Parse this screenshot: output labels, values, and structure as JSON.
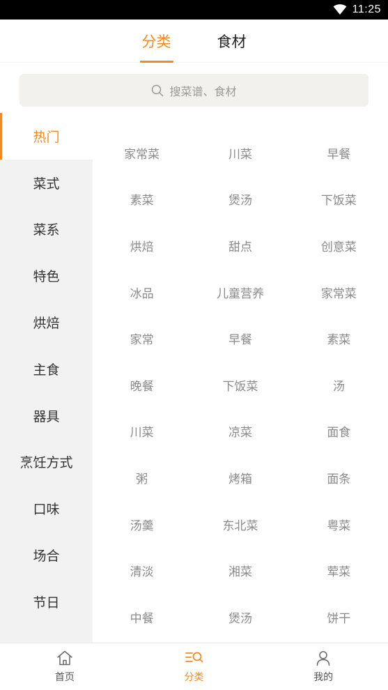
{
  "status_bar": {
    "time": "11:25"
  },
  "top_tabs": [
    {
      "label": "分类",
      "active": true
    },
    {
      "label": "食材",
      "active": false
    }
  ],
  "search": {
    "placeholder": "搜菜谱、食材"
  },
  "sidebar": {
    "items": [
      {
        "label": "热门",
        "active": true
      },
      {
        "label": "菜式"
      },
      {
        "label": "菜系"
      },
      {
        "label": "特色"
      },
      {
        "label": "烘焙"
      },
      {
        "label": "主食"
      },
      {
        "label": "器具"
      },
      {
        "label": "烹饪方式"
      },
      {
        "label": "口味"
      },
      {
        "label": "场合"
      },
      {
        "label": "节日"
      }
    ]
  },
  "grid": {
    "rows": [
      [
        "家常菜",
        "川菜",
        "早餐"
      ],
      [
        "素菜",
        "煲汤",
        "下饭菜"
      ],
      [
        "烘焙",
        "甜点",
        "创意菜"
      ],
      [
        "冰品",
        "儿童营养",
        "家常菜"
      ],
      [
        "家常",
        "早餐",
        "素菜"
      ],
      [
        "晚餐",
        "下饭菜",
        "汤"
      ],
      [
        "川菜",
        "凉菜",
        "面食"
      ],
      [
        "粥",
        "烤箱",
        "面条"
      ],
      [
        "汤羹",
        "东北菜",
        "粤菜"
      ],
      [
        "清淡",
        "湘菜",
        "荤菜"
      ],
      [
        "中餐",
        "煲汤",
        "饼干"
      ]
    ]
  },
  "bottom_nav": {
    "items": [
      {
        "label": "首页",
        "icon": "home-icon"
      },
      {
        "label": "分类",
        "icon": "category-icon",
        "active": true
      },
      {
        "label": "我的",
        "icon": "profile-icon"
      }
    ]
  },
  "colors": {
    "accent": "#f08a24",
    "sidebar_bg": "#f2f2f2",
    "search_bg": "#f2f1ee"
  }
}
